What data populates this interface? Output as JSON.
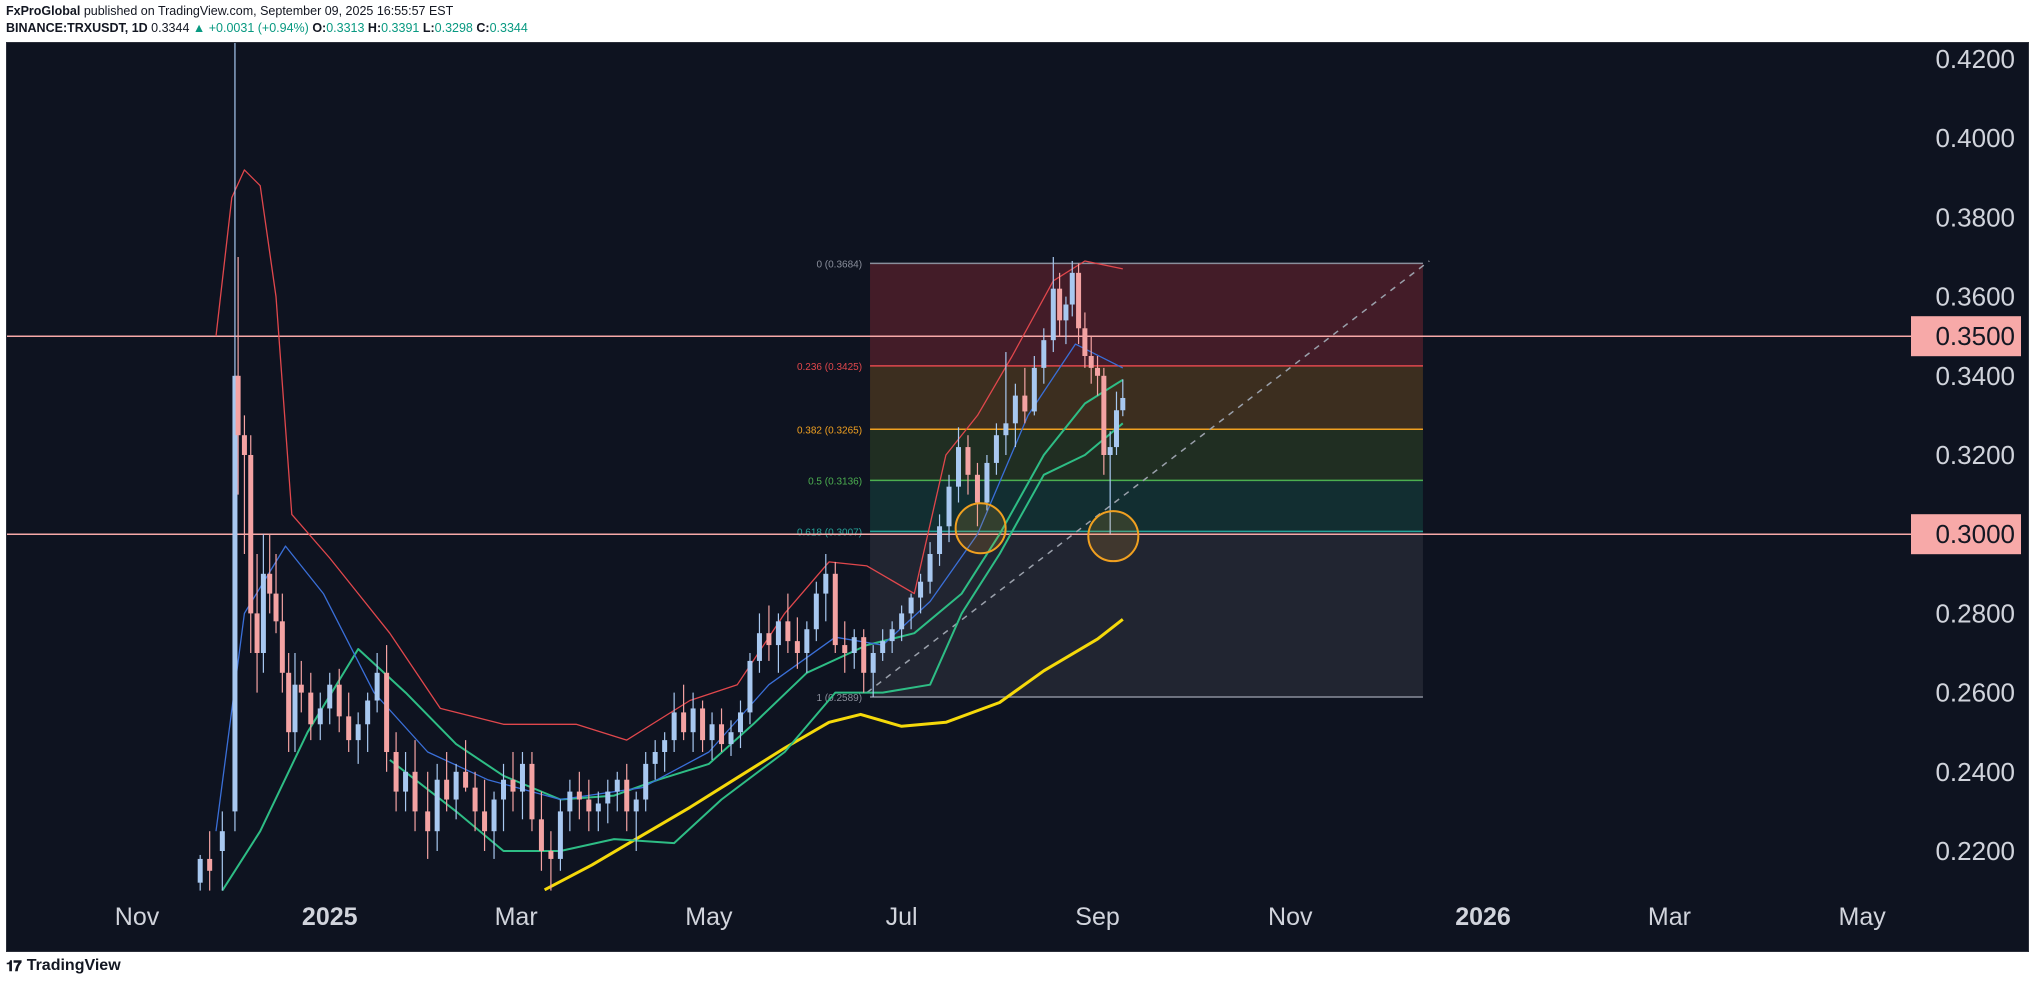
{
  "header": {
    "author": "FxProGlobal",
    "published": "published on TradingView.com, September 09, 2025 16:55:57 EST",
    "symbol": "BINANCE:TRXUSDT, 1D",
    "last": "0.3344",
    "change": "+0.0031 (+0.94%)",
    "open_label": "O:",
    "open": "0.3313",
    "high_label": "H:",
    "high": "0.3391",
    "low_label": "L:",
    "low": "0.3298",
    "close_label": "C:",
    "close": "0.3344"
  },
  "footer": {
    "brand": "TradingView",
    "logo": "tv-logo-icon"
  },
  "colors": {
    "background": "#0e1320",
    "candle_up": "#a8c8f0",
    "candle_down": "#f4a3a3",
    "sma200": "#f5d90a",
    "ema_green": "#2ebd85",
    "ema_blue": "#3a6fd8",
    "bb_red": "#e0474c",
    "hline": "#f7a9a8",
    "circle": "#f0a020"
  },
  "chart_data": {
    "type": "candlestick",
    "ylim": [
      0.21,
      0.43
    ],
    "y_ticks": [
      "0.4200",
      "0.4000",
      "0.3800",
      "0.3600",
      "0.3400",
      "0.3200",
      "0.3000",
      "0.2800",
      "0.2600",
      "0.2400",
      "0.2200"
    ],
    "x_ticks": [
      "Nov",
      "2025",
      "Mar",
      "May",
      "Jul",
      "Sep",
      "Nov",
      "2026",
      "Mar",
      "May"
    ],
    "horizontal_levels": [
      {
        "label": "0.3500",
        "value": 0.35
      },
      {
        "label": "0.3000",
        "value": 0.3
      }
    ],
    "fibonacci": [
      {
        "label": "0 (0.3684)",
        "value": 0.3684,
        "color": "#8a8f9c"
      },
      {
        "label": "0.236 (0.3425)",
        "value": 0.3425,
        "color": "#e0474c"
      },
      {
        "label": "0.382 (0.3265)",
        "value": 0.3265,
        "color": "#f0a020"
      },
      {
        "label": "0.5 (0.3136)",
        "value": 0.3136,
        "color": "#4caf50"
      },
      {
        "label": "0.618 (0.3007)",
        "value": 0.3007,
        "color": "#26a69a"
      },
      {
        "label": "1 (0.2589)",
        "value": 0.2589,
        "color": "#8a8f9c"
      }
    ],
    "trendline": {
      "from": [
        "2025-06-20",
        0.26
      ],
      "to": [
        "2025-12-15",
        0.369
      ]
    },
    "highlight_circles": [
      {
        "date": "2025-07-26",
        "value": 0.3015
      },
      {
        "date": "2025-09-06",
        "value": 0.2995
      }
    ],
    "series": [
      {
        "name": "SMA 200",
        "key": "sma200",
        "points": [
          [
            "2025-03-10",
            0.2102
          ],
          [
            "2025-03-25",
            0.2165
          ],
          [
            "2025-04-10",
            0.224
          ],
          [
            "2025-04-25",
            0.231
          ],
          [
            "2025-05-10",
            0.2385
          ],
          [
            "2025-05-25",
            0.246
          ],
          [
            "2025-06-08",
            0.2525
          ],
          [
            "2025-06-18",
            0.2545
          ],
          [
            "2025-07-01",
            0.2515
          ],
          [
            "2025-07-15",
            0.2525
          ],
          [
            "2025-08-01",
            0.2575
          ],
          [
            "2025-08-15",
            0.2655
          ],
          [
            "2025-09-01",
            0.2735
          ],
          [
            "2025-09-09",
            0.2785
          ]
        ]
      },
      {
        "name": "EMA",
        "key": "ema_green",
        "points": [
          [
            "2024-11-28",
            0.21
          ],
          [
            "2024-12-10",
            0.225
          ],
          [
            "2024-12-25",
            0.25
          ],
          [
            "2025-01-10",
            0.271
          ],
          [
            "2025-01-25",
            0.26
          ],
          [
            "2025-02-10",
            0.247
          ],
          [
            "2025-02-25",
            0.239
          ],
          [
            "2025-03-15",
            0.233
          ],
          [
            "2025-04-01",
            0.234
          ],
          [
            "2025-04-15",
            0.238
          ],
          [
            "2025-05-01",
            0.242
          ],
          [
            "2025-05-15",
            0.252
          ],
          [
            "2025-06-01",
            0.265
          ],
          [
            "2025-06-20",
            0.272
          ],
          [
            "2025-07-05",
            0.275
          ],
          [
            "2025-07-20",
            0.285
          ],
          [
            "2025-08-01",
            0.3
          ],
          [
            "2025-08-15",
            0.32
          ],
          [
            "2025-08-28",
            0.333
          ],
          [
            "2025-09-09",
            0.339
          ]
        ]
      },
      {
        "name": "EMA",
        "key": "ema_blue",
        "points": [
          [
            "2024-11-26",
            0.225
          ],
          [
            "2024-12-05",
            0.28
          ],
          [
            "2024-12-18",
            0.297
          ],
          [
            "2024-12-30",
            0.285
          ],
          [
            "2025-01-15",
            0.26
          ],
          [
            "2025-02-01",
            0.245
          ],
          [
            "2025-02-20",
            0.238
          ],
          [
            "2025-03-15",
            0.233
          ],
          [
            "2025-04-10",
            0.236
          ],
          [
            "2025-05-01",
            0.245
          ],
          [
            "2025-05-20",
            0.262
          ],
          [
            "2025-06-10",
            0.274
          ],
          [
            "2025-06-25",
            0.272
          ],
          [
            "2025-07-10",
            0.283
          ],
          [
            "2025-07-25",
            0.3
          ],
          [
            "2025-08-10",
            0.33
          ],
          [
            "2025-08-25",
            0.348
          ],
          [
            "2025-09-09",
            0.342
          ]
        ]
      },
      {
        "name": "BB upper",
        "key": "bb_red",
        "points": [
          [
            "2024-11-26",
            0.35
          ],
          [
            "2024-12-01",
            0.385
          ],
          [
            "2024-12-05",
            0.392
          ],
          [
            "2024-12-10",
            0.388
          ],
          [
            "2024-12-15",
            0.36
          ],
          [
            "2024-12-20",
            0.305
          ],
          [
            "2025-01-01",
            0.294
          ],
          [
            "2025-01-10",
            0.285
          ],
          [
            "2025-01-20",
            0.275
          ],
          [
            "2025-02-05",
            0.256
          ],
          [
            "2025-02-25",
            0.252
          ],
          [
            "2025-03-20",
            0.252
          ],
          [
            "2025-04-05",
            0.248
          ],
          [
            "2025-04-25",
            0.258
          ],
          [
            "2025-05-10",
            0.262
          ],
          [
            "2025-05-25",
            0.28
          ],
          [
            "2025-06-08",
            0.293
          ],
          [
            "2025-06-20",
            0.292
          ],
          [
            "2025-07-05",
            0.285
          ],
          [
            "2025-07-15",
            0.32
          ],
          [
            "2025-07-25",
            0.33
          ],
          [
            "2025-08-05",
            0.345
          ],
          [
            "2025-08-18",
            0.364
          ],
          [
            "2025-08-28",
            0.369
          ],
          [
            "2025-09-09",
            0.367
          ]
        ]
      },
      {
        "name": "BB lower",
        "key": "ema_green",
        "points": [
          [
            "2025-01-20",
            0.243
          ],
          [
            "2025-02-10",
            0.23
          ],
          [
            "2025-02-25",
            0.22
          ],
          [
            "2025-03-15",
            0.22
          ],
          [
            "2025-04-01",
            0.223
          ],
          [
            "2025-04-20",
            0.222
          ],
          [
            "2025-05-05",
            0.233
          ],
          [
            "2025-05-25",
            0.245
          ],
          [
            "2025-06-10",
            0.26
          ],
          [
            "2025-06-25",
            0.26
          ],
          [
            "2025-07-10",
            0.262
          ],
          [
            "2025-07-20",
            0.28
          ],
          [
            "2025-08-01",
            0.295
          ],
          [
            "2025-08-15",
            0.315
          ],
          [
            "2025-08-28",
            0.32
          ],
          [
            "2025-09-09",
            0.328
          ]
        ]
      }
    ],
    "candles": [
      [
        "2024-11-21",
        0.212,
        0.219,
        0.21,
        0.218
      ],
      [
        "2024-11-24",
        0.218,
        0.225,
        0.21,
        0.215
      ],
      [
        "2024-11-28",
        0.22,
        0.23,
        0.21,
        0.225
      ],
      [
        "2024-12-02",
        0.23,
        0.43,
        0.225,
        0.34
      ],
      [
        "2024-12-03",
        0.34,
        0.37,
        0.31,
        0.325
      ],
      [
        "2024-12-05",
        0.325,
        0.33,
        0.295,
        0.32
      ],
      [
        "2024-12-07",
        0.32,
        0.325,
        0.27,
        0.28
      ],
      [
        "2024-12-09",
        0.28,
        0.295,
        0.26,
        0.27
      ],
      [
        "2024-12-11",
        0.27,
        0.3,
        0.265,
        0.29
      ],
      [
        "2024-12-13",
        0.29,
        0.3,
        0.28,
        0.285
      ],
      [
        "2024-12-15",
        0.285,
        0.295,
        0.275,
        0.278
      ],
      [
        "2024-12-17",
        0.278,
        0.285,
        0.26,
        0.265
      ],
      [
        "2024-12-19",
        0.265,
        0.27,
        0.245,
        0.25
      ],
      [
        "2024-12-21",
        0.25,
        0.27,
        0.245,
        0.262
      ],
      [
        "2024-12-23",
        0.262,
        0.268,
        0.255,
        0.26
      ],
      [
        "2024-12-26",
        0.26,
        0.265,
        0.248,
        0.252
      ],
      [
        "2024-12-29",
        0.252,
        0.26,
        0.248,
        0.256
      ],
      [
        "2025-01-01",
        0.256,
        0.265,
        0.252,
        0.262
      ],
      [
        "2025-01-04",
        0.262,
        0.266,
        0.25,
        0.254
      ],
      [
        "2025-01-07",
        0.254,
        0.26,
        0.245,
        0.248
      ],
      [
        "2025-01-10",
        0.248,
        0.255,
        0.242,
        0.252
      ],
      [
        "2025-01-13",
        0.252,
        0.26,
        0.245,
        0.258
      ],
      [
        "2025-01-16",
        0.258,
        0.27,
        0.255,
        0.265
      ],
      [
        "2025-01-19",
        0.265,
        0.272,
        0.24,
        0.245
      ],
      [
        "2025-01-22",
        0.245,
        0.25,
        0.23,
        0.235
      ],
      [
        "2025-01-25",
        0.235,
        0.245,
        0.23,
        0.24
      ],
      [
        "2025-01-28",
        0.24,
        0.248,
        0.225,
        0.23
      ],
      [
        "2025-02-01",
        0.23,
        0.24,
        0.218,
        0.225
      ],
      [
        "2025-02-04",
        0.225,
        0.242,
        0.22,
        0.238
      ],
      [
        "2025-02-07",
        0.238,
        0.245,
        0.23,
        0.233
      ],
      [
        "2025-02-10",
        0.233,
        0.242,
        0.228,
        0.24
      ],
      [
        "2025-02-13",
        0.24,
        0.248,
        0.235,
        0.236
      ],
      [
        "2025-02-16",
        0.236,
        0.24,
        0.225,
        0.23
      ],
      [
        "2025-02-19",
        0.23,
        0.238,
        0.22,
        0.225
      ],
      [
        "2025-02-22",
        0.225,
        0.235,
        0.218,
        0.233
      ],
      [
        "2025-02-25",
        0.233,
        0.242,
        0.225,
        0.238
      ],
      [
        "2025-02-28",
        0.238,
        0.245,
        0.23,
        0.235
      ],
      [
        "2025-03-03",
        0.235,
        0.245,
        0.228,
        0.242
      ],
      [
        "2025-03-06",
        0.242,
        0.245,
        0.225,
        0.228
      ],
      [
        "2025-03-09",
        0.228,
        0.235,
        0.215,
        0.22
      ],
      [
        "2025-03-12",
        0.22,
        0.225,
        0.21,
        0.218
      ],
      [
        "2025-03-15",
        0.218,
        0.233,
        0.215,
        0.23
      ],
      [
        "2025-03-18",
        0.23,
        0.238,
        0.225,
        0.235
      ],
      [
        "2025-03-21",
        0.235,
        0.24,
        0.228,
        0.233
      ],
      [
        "2025-03-24",
        0.233,
        0.238,
        0.225,
        0.23
      ],
      [
        "2025-03-27",
        0.23,
        0.235,
        0.225,
        0.232
      ],
      [
        "2025-03-30",
        0.232,
        0.238,
        0.227,
        0.235
      ],
      [
        "2025-04-02",
        0.235,
        0.24,
        0.23,
        0.238
      ],
      [
        "2025-04-05",
        0.238,
        0.242,
        0.225,
        0.23
      ],
      [
        "2025-04-08",
        0.23,
        0.235,
        0.22,
        0.233
      ],
      [
        "2025-04-11",
        0.233,
        0.245,
        0.23,
        0.242
      ],
      [
        "2025-04-14",
        0.242,
        0.248,
        0.238,
        0.245
      ],
      [
        "2025-04-17",
        0.245,
        0.25,
        0.24,
        0.248
      ],
      [
        "2025-04-20",
        0.248,
        0.26,
        0.245,
        0.255
      ],
      [
        "2025-04-23",
        0.255,
        0.262,
        0.248,
        0.25
      ],
      [
        "2025-04-26",
        0.25,
        0.26,
        0.245,
        0.256
      ],
      [
        "2025-04-29",
        0.256,
        0.258,
        0.245,
        0.248
      ],
      [
        "2025-05-02",
        0.248,
        0.255,
        0.243,
        0.252
      ],
      [
        "2025-05-05",
        0.252,
        0.256,
        0.245,
        0.247
      ],
      [
        "2025-05-08",
        0.247,
        0.253,
        0.244,
        0.25
      ],
      [
        "2025-05-11",
        0.25,
        0.258,
        0.246,
        0.255
      ],
      [
        "2025-05-14",
        0.255,
        0.27,
        0.252,
        0.268
      ],
      [
        "2025-05-17",
        0.268,
        0.28,
        0.265,
        0.275
      ],
      [
        "2025-05-20",
        0.275,
        0.282,
        0.268,
        0.272
      ],
      [
        "2025-05-23",
        0.272,
        0.28,
        0.265,
        0.278
      ],
      [
        "2025-05-26",
        0.278,
        0.285,
        0.27,
        0.273
      ],
      [
        "2025-05-29",
        0.273,
        0.279,
        0.266,
        0.27
      ],
      [
        "2025-06-01",
        0.27,
        0.278,
        0.265,
        0.276
      ],
      [
        "2025-06-04",
        0.276,
        0.288,
        0.273,
        0.285
      ],
      [
        "2025-06-07",
        0.285,
        0.295,
        0.278,
        0.29
      ],
      [
        "2025-06-10",
        0.29,
        0.293,
        0.27,
        0.272
      ],
      [
        "2025-06-13",
        0.272,
        0.278,
        0.265,
        0.27
      ],
      [
        "2025-06-16",
        0.27,
        0.276,
        0.266,
        0.274
      ],
      [
        "2025-06-19",
        0.274,
        0.276,
        0.26,
        0.265
      ],
      [
        "2025-06-22",
        0.265,
        0.272,
        0.2589,
        0.27
      ],
      [
        "2025-06-25",
        0.27,
        0.276,
        0.268,
        0.273
      ],
      [
        "2025-06-28",
        0.273,
        0.278,
        0.27,
        0.276
      ],
      [
        "2025-07-01",
        0.276,
        0.282,
        0.273,
        0.28
      ],
      [
        "2025-07-04",
        0.28,
        0.285,
        0.276,
        0.284
      ],
      [
        "2025-07-07",
        0.284,
        0.29,
        0.28,
        0.288
      ],
      [
        "2025-07-10",
        0.288,
        0.298,
        0.285,
        0.295
      ],
      [
        "2025-07-13",
        0.295,
        0.305,
        0.292,
        0.302
      ],
      [
        "2025-07-16",
        0.302,
        0.315,
        0.298,
        0.312
      ],
      [
        "2025-07-19",
        0.312,
        0.327,
        0.308,
        0.322
      ],
      [
        "2025-07-22",
        0.322,
        0.325,
        0.31,
        0.315
      ],
      [
        "2025-07-25",
        0.315,
        0.318,
        0.302,
        0.308
      ],
      [
        "2025-07-28",
        0.308,
        0.32,
        0.306,
        0.318
      ],
      [
        "2025-07-31",
        0.318,
        0.328,
        0.315,
        0.325
      ],
      [
        "2025-08-03",
        0.325,
        0.346,
        0.32,
        0.328
      ],
      [
        "2025-08-06",
        0.328,
        0.338,
        0.322,
        0.335
      ],
      [
        "2025-08-09",
        0.335,
        0.342,
        0.328,
        0.331
      ],
      [
        "2025-08-12",
        0.331,
        0.345,
        0.33,
        0.342
      ],
      [
        "2025-08-15",
        0.342,
        0.352,
        0.338,
        0.349
      ],
      [
        "2025-08-18",
        0.349,
        0.37,
        0.346,
        0.362
      ],
      [
        "2025-08-20",
        0.362,
        0.366,
        0.35,
        0.354
      ],
      [
        "2025-08-22",
        0.354,
        0.36,
        0.348,
        0.358
      ],
      [
        "2025-08-24",
        0.358,
        0.369,
        0.355,
        0.366
      ],
      [
        "2025-08-26",
        0.366,
        0.3684,
        0.348,
        0.352
      ],
      [
        "2025-08-28",
        0.352,
        0.356,
        0.342,
        0.345
      ],
      [
        "2025-08-30",
        0.345,
        0.35,
        0.338,
        0.342
      ],
      [
        "2025-09-01",
        0.342,
        0.345,
        0.335,
        0.34
      ],
      [
        "2025-09-03",
        0.34,
        0.342,
        0.315,
        0.32
      ],
      [
        "2025-09-05",
        0.32,
        0.326,
        0.3,
        0.322
      ],
      [
        "2025-09-07",
        0.322,
        0.336,
        0.32,
        0.3313
      ],
      [
        "2025-09-09",
        0.3313,
        0.3391,
        0.3298,
        0.3344
      ]
    ]
  }
}
